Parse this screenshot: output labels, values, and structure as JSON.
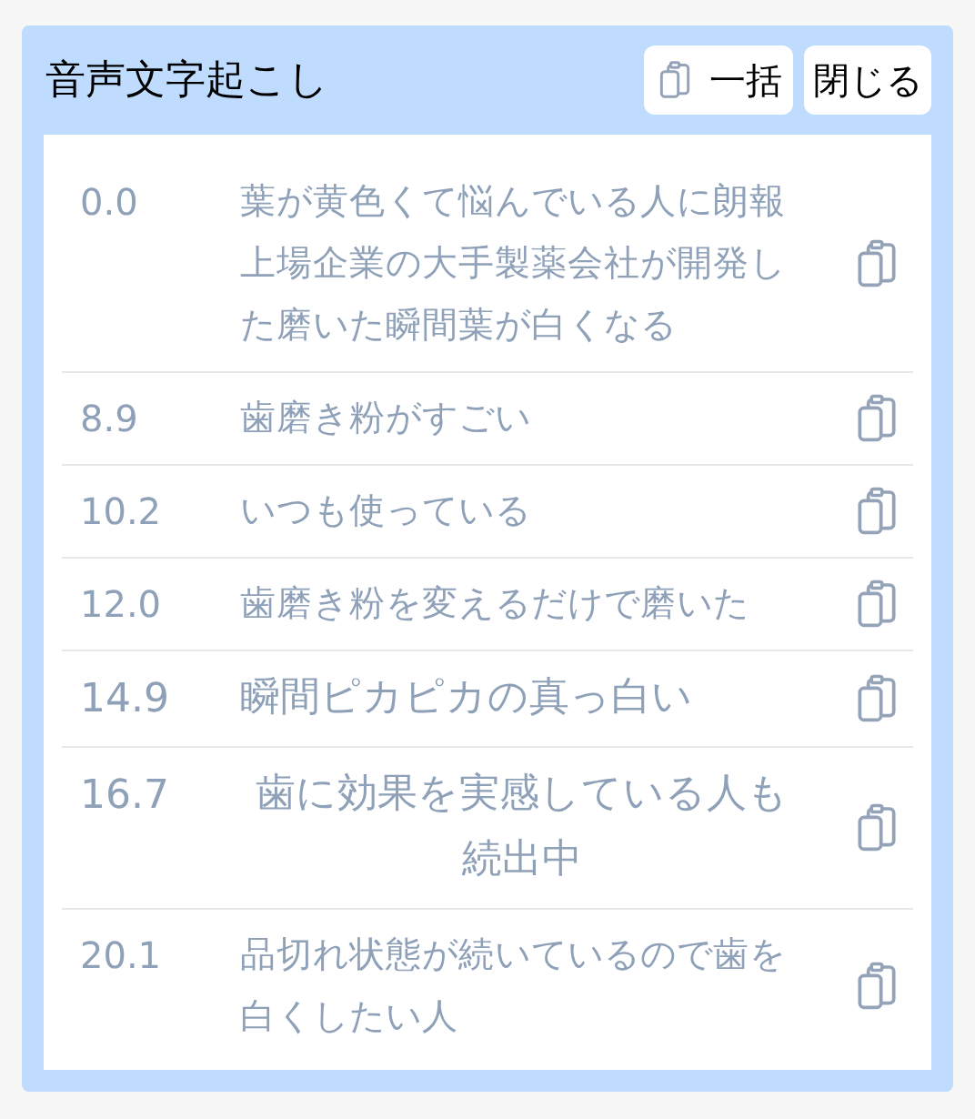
{
  "panel": {
    "title": "音声文字起こし",
    "copy_all_button": "一括",
    "close_button": "閉じる"
  },
  "rows": [
    {
      "time": "0.0",
      "text": "葉が黄色くて悩んでいる人に朗報上場企業の大手製薬会社が開発した磨いた瞬間葉が白くなる",
      "large": false,
      "centered": false
    },
    {
      "time": "8.9",
      "text": "歯磨き粉がすごい",
      "large": false,
      "centered": false
    },
    {
      "time": "10.2",
      "text": "いつも使っている",
      "large": false,
      "centered": false
    },
    {
      "time": "12.0",
      "text": "歯磨き粉を変えるだけで磨いた",
      "large": false,
      "centered": false
    },
    {
      "time": "14.9",
      "text": "瞬間ピカピカの真っ白い",
      "large": true,
      "centered": false
    },
    {
      "time": "16.7",
      "text": "歯に効果を実感している人も続出中",
      "large": true,
      "centered": true
    },
    {
      "time": "20.1",
      "text": "品切れ状態が続いているので歯を白くしたい人",
      "large": false,
      "centered": false
    }
  ]
}
